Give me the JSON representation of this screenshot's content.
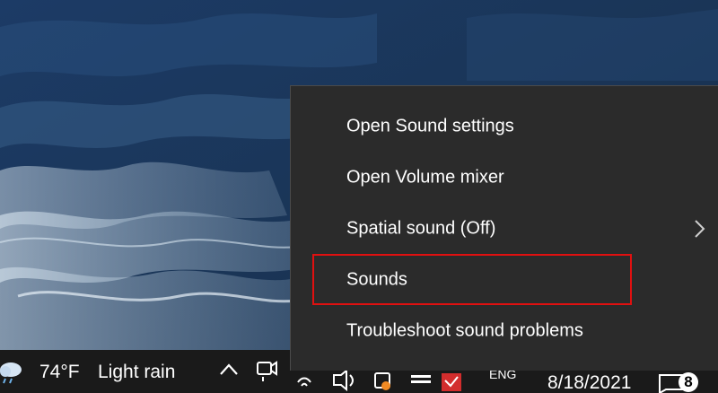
{
  "taskbar": {
    "weather_temp": "74°F",
    "weather_condition": "Light rain",
    "date": "8/18/2021",
    "notification_count": "8",
    "language_partial": "ENG"
  },
  "context_menu": {
    "items": [
      {
        "label": "Open Sound settings",
        "has_submenu": false
      },
      {
        "label": "Open Volume mixer",
        "has_submenu": false
      },
      {
        "label": "Spatial sound (Off)",
        "has_submenu": true
      },
      {
        "label": "Sounds",
        "has_submenu": false,
        "highlighted": true
      },
      {
        "label": "Troubleshoot sound problems",
        "has_submenu": false
      }
    ]
  },
  "colors": {
    "menu_background": "#2b2b2b",
    "menu_text": "#ffffff",
    "highlight_border": "#e01010",
    "taskbar_background": "#1a1a1a"
  }
}
